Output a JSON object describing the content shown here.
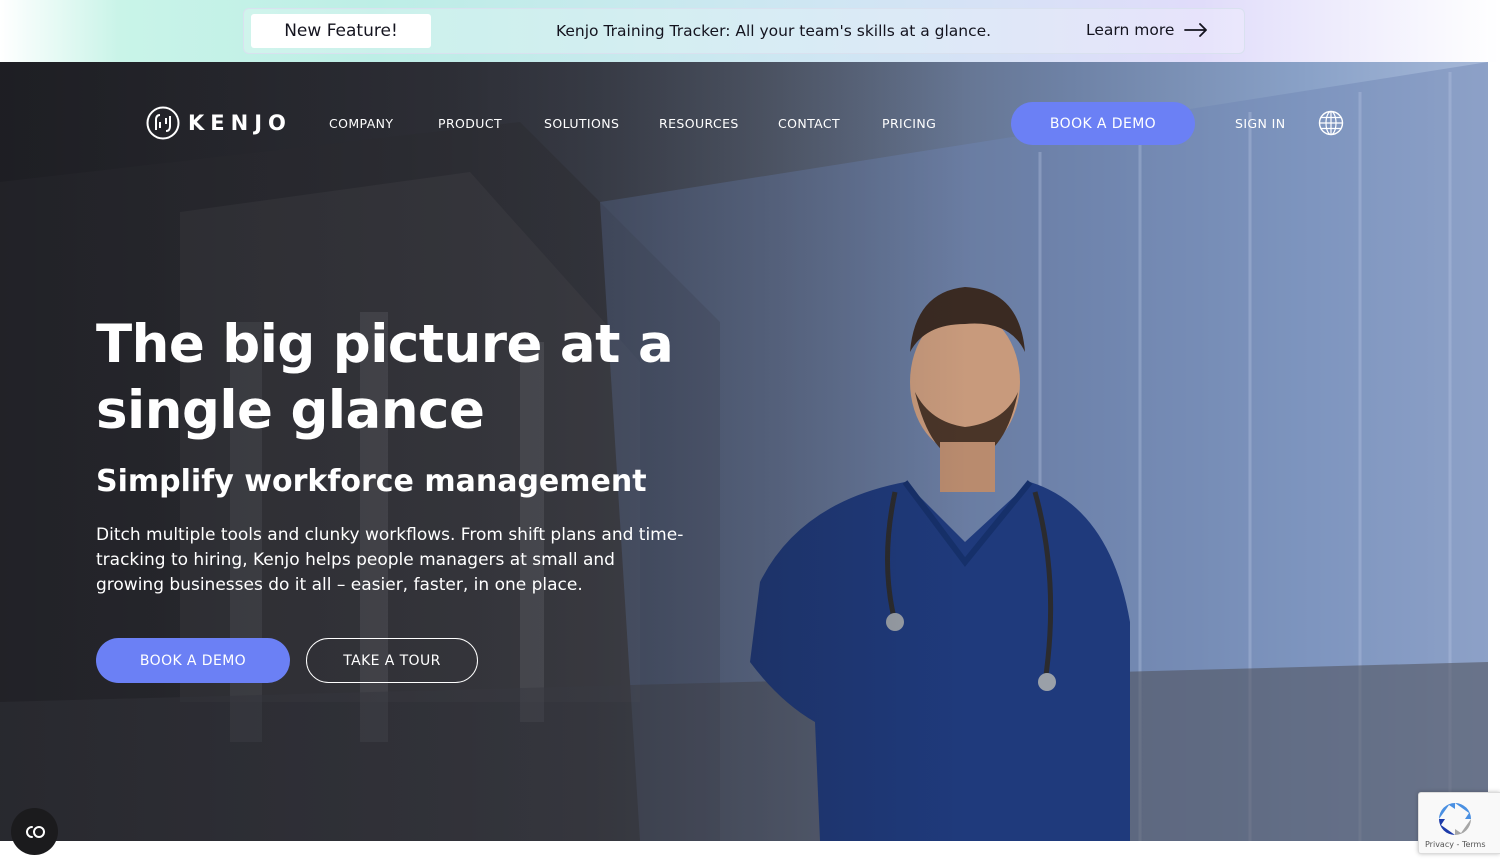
{
  "announcement": {
    "badge": "New Feature!",
    "text": "Kenjo Training Tracker: All your team's skills at a glance.",
    "link_label": "Learn more"
  },
  "nav": {
    "logo_text": "KENJO",
    "items": [
      {
        "label": "COMPANY"
      },
      {
        "label": "PRODUCT"
      },
      {
        "label": "SOLUTIONS"
      },
      {
        "label": "RESOURCES"
      },
      {
        "label": "CONTACT"
      },
      {
        "label": "PRICING"
      }
    ],
    "cta_label": "BOOK A DEMO",
    "signin_label": "SIGN IN",
    "language_icon": "globe-icon"
  },
  "hero": {
    "title": "The big picture at a single glance",
    "subtitle": "Simplify workforce management",
    "description": "Ditch multiple tools and clunky workflows. From shift plans and time-tracking to hiring, Kenjo helps people managers at small and growing businesses do it all – easier, faster, in one place.",
    "primary_cta": "BOOK A DEMO",
    "secondary_cta": "TAKE A TOUR"
  },
  "widgets": {
    "recaptcha_links": "Privacy - Terms",
    "cookie_icon": "cookie-settings-icon"
  },
  "colors": {
    "accent": "#6b80f5",
    "text_dark": "#14141f",
    "hero_text": "#ffffff"
  }
}
